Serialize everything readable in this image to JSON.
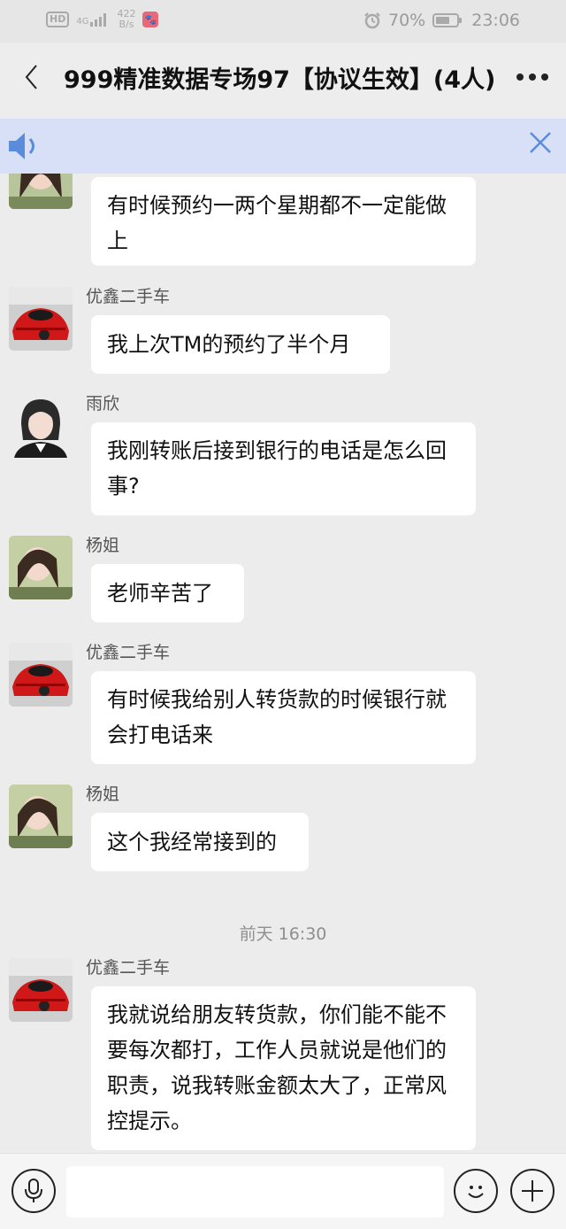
{
  "status_bar": {
    "hd_label": "HD",
    "signal_label": "4G",
    "speed_value": "422",
    "speed_unit": "B/s",
    "battery_percent": "70%",
    "time": "23:06",
    "battery_level": 0.7
  },
  "header": {
    "back_icon": "chevron-left",
    "title": "999精准数据专场97【协议生效】(4人)",
    "more_icon": "more-dots"
  },
  "notice": {
    "speaker_icon": "speaker",
    "close_icon": "close"
  },
  "messages": [
    {
      "sender": "",
      "avatar": "girl",
      "text": "有时候预约一两个星期都不一定能做上"
    },
    {
      "sender": "优鑫二手车",
      "avatar": "car",
      "text": "我上次TM的预约了半个月"
    },
    {
      "sender": "雨欣",
      "avatar": "yuxin",
      "text": "我刚转账后接到银行的电话是怎么回事?"
    },
    {
      "sender": "杨姐",
      "avatar": "girl",
      "text": "老师辛苦了"
    },
    {
      "sender": "优鑫二手车",
      "avatar": "car",
      "text": "有时候我给别人转货款的时候银行就会打电话来"
    },
    {
      "sender": "杨姐",
      "avatar": "girl",
      "text": "这个我经常接到的"
    },
    {
      "sender": "优鑫二手车",
      "avatar": "car",
      "text": "我就说给朋友转货款，你们能不能不要每次都打，工作人员就说是他们的职责，说我转账金额太大了，正常风控提示。"
    }
  ],
  "timestamp": "前天 16:30",
  "input_bar": {
    "voice_icon": "microphone",
    "emoji_icon": "smiley",
    "plus_icon": "plus"
  },
  "colors": {
    "notice_bg": "#d7e0f7",
    "accent_blue": "#5a8cdc",
    "chat_bg": "#ececec"
  }
}
